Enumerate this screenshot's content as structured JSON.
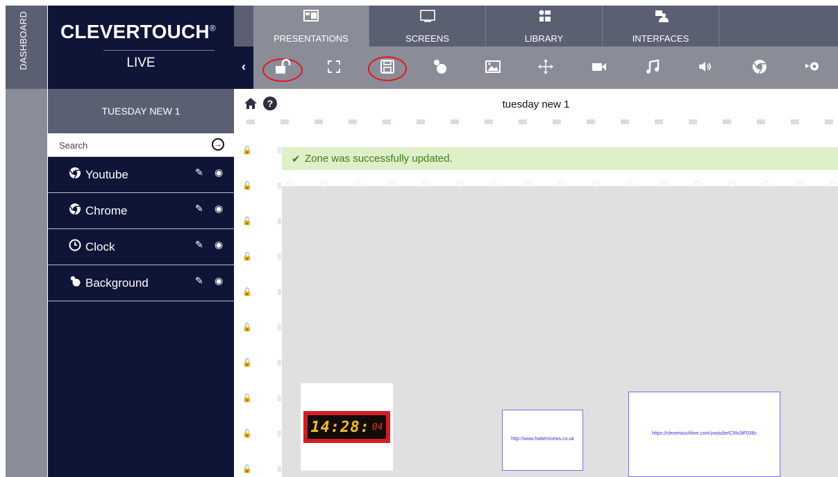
{
  "dashboard": {
    "label": "DASHBOARD"
  },
  "brand": {
    "name": "CLEVERTOUCH",
    "reg": "®",
    "sub": "LIVE"
  },
  "presentation": {
    "name": "TUESDAY NEW 1"
  },
  "search": {
    "placeholder": "Search"
  },
  "zones": [
    {
      "label": "Youtube",
      "icon": "chrome-icon"
    },
    {
      "label": "Chrome",
      "icon": "chrome-icon"
    },
    {
      "label": "Clock",
      "icon": "clock-icon"
    },
    {
      "label": "Background",
      "icon": "shapes-icon"
    }
  ],
  "tabs": [
    {
      "label": "PRESENTATIONS",
      "icon": "presentation-icon",
      "active": true
    },
    {
      "label": "SCREENS",
      "icon": "monitor-icon",
      "active": false
    },
    {
      "label": "LIBRARY",
      "icon": "library-icon",
      "active": false
    },
    {
      "label": "INTERFACES",
      "icon": "interfaces-icon",
      "active": false
    }
  ],
  "toolbar": {
    "icons": [
      "back-icon",
      "unlock-icon",
      "fullscreen-icon",
      "save-icon",
      "shapes-icon",
      "image-icon",
      "move-icon",
      "video-icon",
      "music-icon",
      "volume-icon",
      "chrome-icon",
      "youtube-icon"
    ],
    "highlighted": [
      "unlock-icon",
      "save-icon"
    ],
    "highlight_color": "#e8141b"
  },
  "canvas": {
    "title": "tuesday new 1",
    "alert": "Zone was successfully updated.",
    "clock": {
      "main": "14:28:",
      "seconds": "04"
    },
    "url_small": "http://www.hattersnews.co.uk",
    "url_large": "https://clevertouchlive.com/youtube/C9Is3tF038c"
  },
  "colors": {
    "navy": "#0e1537",
    "slate": "#5b5f72",
    "grey": "#8a8d98",
    "success_bg": "#dff0c8",
    "success_text": "#3b7d1a"
  }
}
